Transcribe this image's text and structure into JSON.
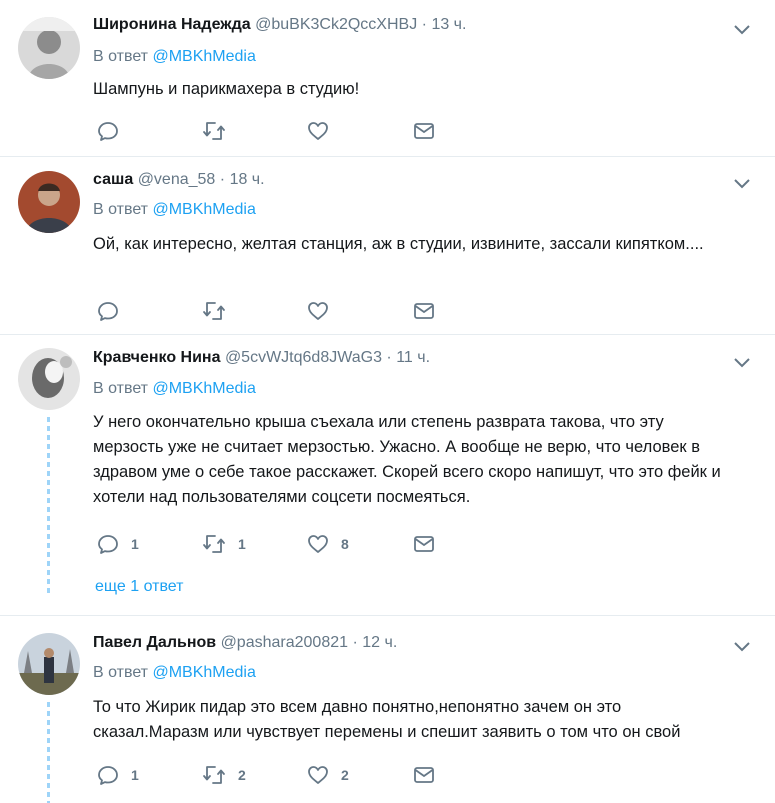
{
  "tweets": [
    {
      "name": "Широнина Надежда",
      "handle": "@buBK3Ck2QccXHBJ",
      "time": "13 ч.",
      "reply_prefix": "В ответ",
      "reply_mention": "@MBKhMedia",
      "text": "Шампунь и парикмахера в студию!",
      "counts": {
        "reply": "",
        "retweet": "",
        "like": ""
      }
    },
    {
      "name": "саша",
      "handle": "@vena_58",
      "time": "18 ч.",
      "reply_prefix": "В ответ",
      "reply_mention": "@MBKhMedia",
      "text": "Ой, как интересно, желтая станция, аж в студии, извините, зассали кипятком....",
      "counts": {
        "reply": "",
        "retweet": "",
        "like": ""
      }
    },
    {
      "name": "Кравченко Нина",
      "handle": "@5cvWJtq6d8JWaG3",
      "time": "11 ч.",
      "reply_prefix": "В ответ",
      "reply_mention": "@MBKhMedia",
      "text": "У него окончательно крыша съехала или степень разврата такова, что эту мерзость уже не считает мерзостью. Ужасно. А вообще не верю, что человек в здравом уме о себе такое расскажет. Скорей всего скоро напишут, что это фейк и хотели над пользователями соцсети посмеяться.",
      "counts": {
        "reply": "1",
        "retweet": "1",
        "like": "8"
      },
      "more_replies": "еще 1 ответ"
    },
    {
      "name": "Павел Дальнов",
      "handle": "@pashara200821",
      "time": "12 ч.",
      "reply_prefix": "В ответ",
      "reply_mention": "@MBKhMedia",
      "text": "То что Жирик пидар это всем давно понятно,непонятно зачем он это сказал.Маразм или чувствует перемены и спешит заявить о том что он свой",
      "counts": {
        "reply": "1",
        "retweet": "2",
        "like": "2"
      }
    }
  ],
  "separator": "·",
  "icons": [
    "reply-icon",
    "retweet-icon",
    "like-icon",
    "direct-message-icon",
    "chevron-down-icon"
  ],
  "colors": {
    "link": "#1da1f2",
    "muted": "#657786",
    "text": "#14171a",
    "thread_line": "#9ed4f8",
    "divider": "#e6ecf0"
  }
}
